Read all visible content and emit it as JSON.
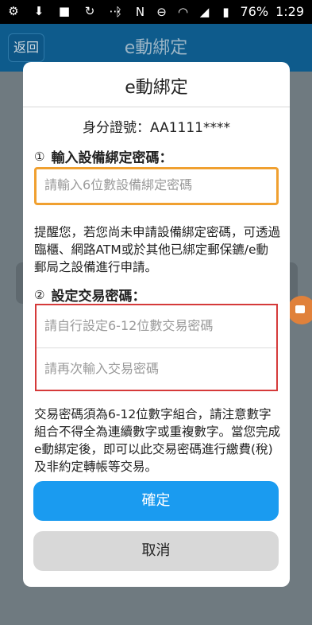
{
  "status_bar": {
    "battery": "76%",
    "time": "1:29",
    "left_icons": [
      "settings-icon",
      "download-icon",
      "video-icon",
      "sync-icon",
      "more-icon"
    ],
    "right_icons": [
      "bluetooth-icon",
      "nfc-icon",
      "dnd-icon",
      "wifi-icon",
      "signal-icon",
      "battery-icon"
    ]
  },
  "background": {
    "back_label": "返回",
    "title": "e動綁定"
  },
  "dialog": {
    "title": "e動綁定",
    "id_line": "身分證號：AA1111****",
    "section1": {
      "number": "①",
      "title": "輸入設備綁定密碼："
    },
    "bind_password_placeholder": "請輸入6位數設備綁定密碼",
    "reminder": "提醒您，若您尚未申請設備綁定密碼，可透過臨櫃、網路ATM或於其他已綁定郵保鑣/e動郵局之設備進行申請。",
    "section2": {
      "number": "②",
      "title": "設定交易密碼："
    },
    "trade_password_placeholder": "請自行設定6-12位數交易密碼",
    "trade_password_confirm_placeholder": "請再次輸入交易密碼",
    "notice": "交易密碼須為6-12位數字組合，請注意數字組合不得全為連續數字或重複數字。當您完成e動綁定後，即可以此交易密碼進行繳費(稅)及非約定轉帳等交易。",
    "confirm_label": "確定",
    "cancel_label": "取消"
  },
  "colors": {
    "primary": "#1a9bf0",
    "focus_border": "#f0a030",
    "error_border": "#d53a3a",
    "appbar": "#0e5b8c"
  }
}
